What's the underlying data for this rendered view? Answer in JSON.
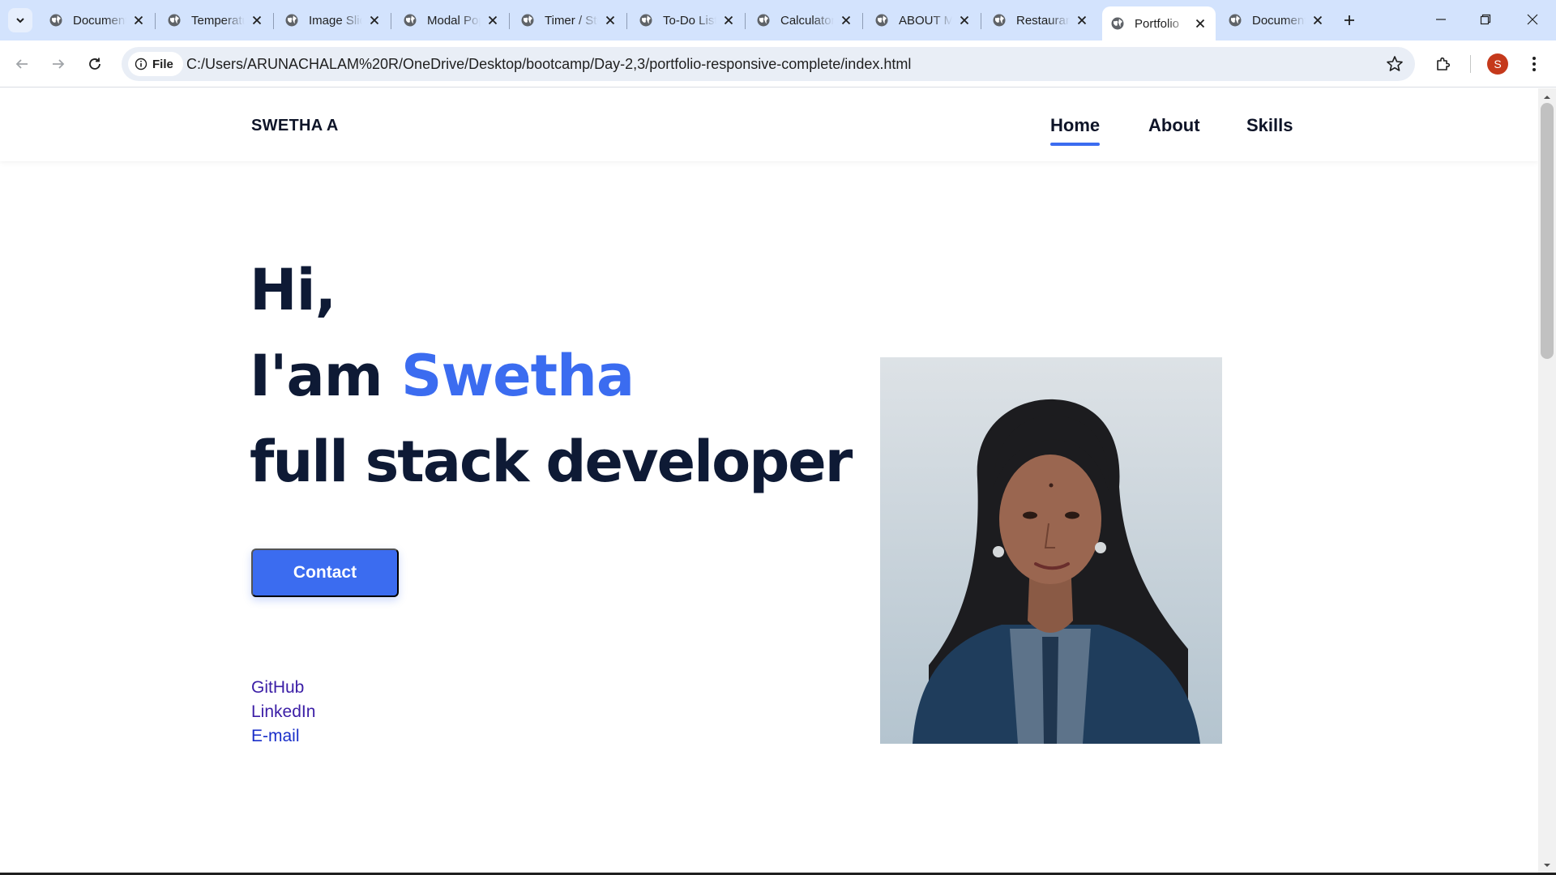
{
  "browser": {
    "tabs": [
      {
        "title": "Document"
      },
      {
        "title": "Temperature"
      },
      {
        "title": "Image Slider"
      },
      {
        "title": "Modal Popup"
      },
      {
        "title": "Timer / Stopwatch"
      },
      {
        "title": "To-Do List"
      },
      {
        "title": "Calculator"
      },
      {
        "title": "ABOUT ME"
      },
      {
        "title": "Restaurant"
      },
      {
        "title": "Portfolio"
      },
      {
        "title": "Document"
      }
    ],
    "active_tab_index": 9,
    "address": {
      "chip_label": "File",
      "url": "C:/Users/ARUNACHALAM%20R/OneDrive/Desktop/bootcamp/Day-2,3/portfolio-responsive-complete/index.html"
    },
    "profile_initial": "S",
    "colors": {
      "tabstrip": "#d3e3fd",
      "omnibox": "#e9eef6",
      "avatar": "#c5391b"
    }
  },
  "page": {
    "header": {
      "brand": "SWETHA A",
      "nav": [
        {
          "label": "Home",
          "active": true
        },
        {
          "label": "About",
          "active": false
        },
        {
          "label": "Skills",
          "active": false
        }
      ]
    },
    "hero": {
      "greeting": "Hi,",
      "intro_prefix": "I'am",
      "name": "Swetha",
      "role": "full stack developer",
      "contact_button": "Contact"
    },
    "social_links": [
      "GitHub",
      "LinkedIn",
      "E-mail"
    ],
    "photo": {
      "alt": "Profile photo"
    },
    "colors": {
      "accent": "#3b6cf0",
      "heading": "#0e1a35",
      "link": "#3b1ea6"
    }
  }
}
